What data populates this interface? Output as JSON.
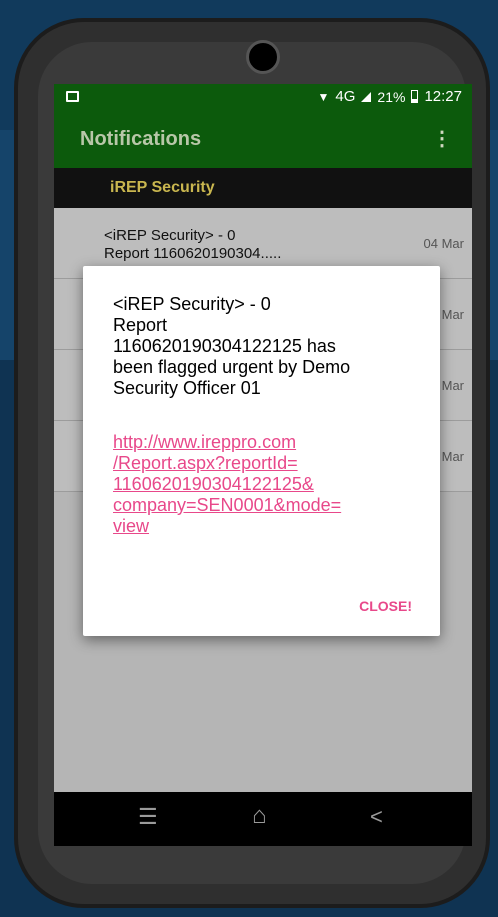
{
  "status_bar": {
    "network": "4G",
    "battery": "21%",
    "time": "12:27"
  },
  "app_bar": {
    "title": "Notifications",
    "menu_icon": "overflow-menu-icon"
  },
  "section": {
    "title": "iREP Security"
  },
  "notifications": [
    {
      "line1": "<iREP Security> - 0",
      "line2": "Report 1160620190304.....",
      "date": "04 Mar"
    },
    {
      "line1": "",
      "line2": "",
      "date": "Mar"
    },
    {
      "line1": "",
      "line2": "",
      "date": "Mar"
    },
    {
      "line1": "",
      "line2": "",
      "date": "Mar"
    }
  ],
  "dialog": {
    "message": "<iREP Security> - 0\nReport\n1160620190304122125 has\nbeen flagged urgent by Demo\nSecurity Officer 01",
    "link": "http://www.ireppro.com\n/Report.aspx?reportId=\n1160620190304122125&\ncompany=SEN0001&mode=\nview",
    "close_label": "CLOSE!"
  },
  "nav_bar": {
    "menu": "☰",
    "home": "⌂",
    "back": "<"
  },
  "colors": {
    "app_bar": "#0c5a0c",
    "section_text": "#c9b64f",
    "link": "#e8488a"
  }
}
